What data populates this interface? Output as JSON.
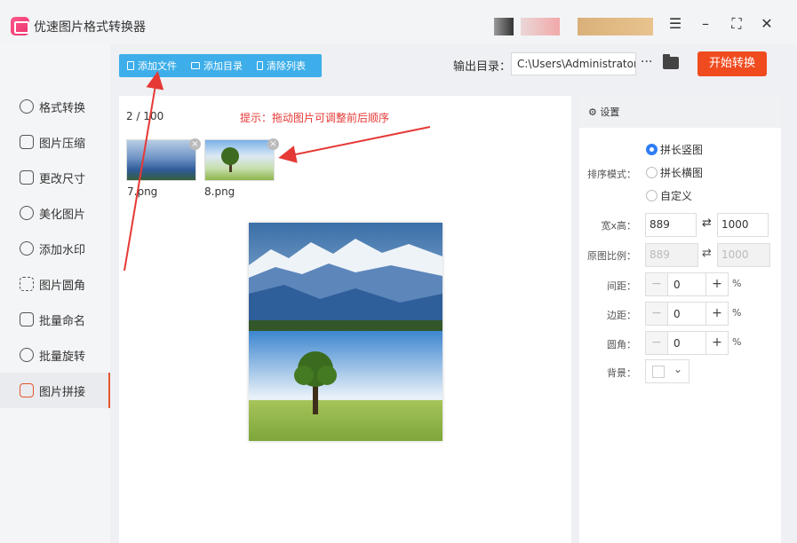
{
  "app": {
    "title": "优速图片格式转换器"
  },
  "window": {
    "menu_icon": "☰",
    "min_icon": "–",
    "max_icon": "⛶",
    "close_icon": "✕"
  },
  "sidebar": {
    "items": [
      {
        "label": "格式转换",
        "icon": "convert-icon"
      },
      {
        "label": "图片压缩",
        "icon": "compress-icon"
      },
      {
        "label": "更改尺寸",
        "icon": "resize-icon"
      },
      {
        "label": "美化图片",
        "icon": "beautify-icon"
      },
      {
        "label": "添加水印",
        "icon": "watermark-icon"
      },
      {
        "label": "图片圆角",
        "icon": "round-corner-icon"
      },
      {
        "label": "批量命名",
        "icon": "rename-icon"
      },
      {
        "label": "批量旋转",
        "icon": "rotate-icon"
      },
      {
        "label": "图片拼接",
        "icon": "stitch-icon",
        "active": true
      }
    ]
  },
  "toolbar": {
    "add_file": "添加文件",
    "add_dir": "添加目录",
    "clear": "清除列表"
  },
  "output": {
    "label": "输出目录：",
    "path": "C:\\Users\\Administrator\\",
    "more": "···",
    "start": "开始转换"
  },
  "files": {
    "count": "2 / 100",
    "hint": "提示：拖动图片可调整前后顺序",
    "items": [
      {
        "name": "7.png"
      },
      {
        "name": "8.png"
      }
    ]
  },
  "settings": {
    "title": "设置",
    "sort_label": "排序模式：",
    "options": [
      "拼长竖图",
      "拼长横图",
      "自定义"
    ],
    "selected": "拼长竖图",
    "size_label": "宽x高：",
    "width": "889",
    "height": "1000",
    "ratio_label": "原图比例：",
    "ratio_w": "889",
    "ratio_h": "1000",
    "gap_label": "间距：",
    "gap": "0",
    "margin_label": "边距：",
    "margin": "0",
    "radius_label": "圆角：",
    "radius": "0",
    "unit": "%",
    "bg_label": "背景：",
    "minus": "−",
    "plus": "+"
  },
  "colors": {
    "accent": "#3daee9",
    "start": "#f04b1f",
    "hint": "#e53935",
    "arrow": "#e53935"
  }
}
